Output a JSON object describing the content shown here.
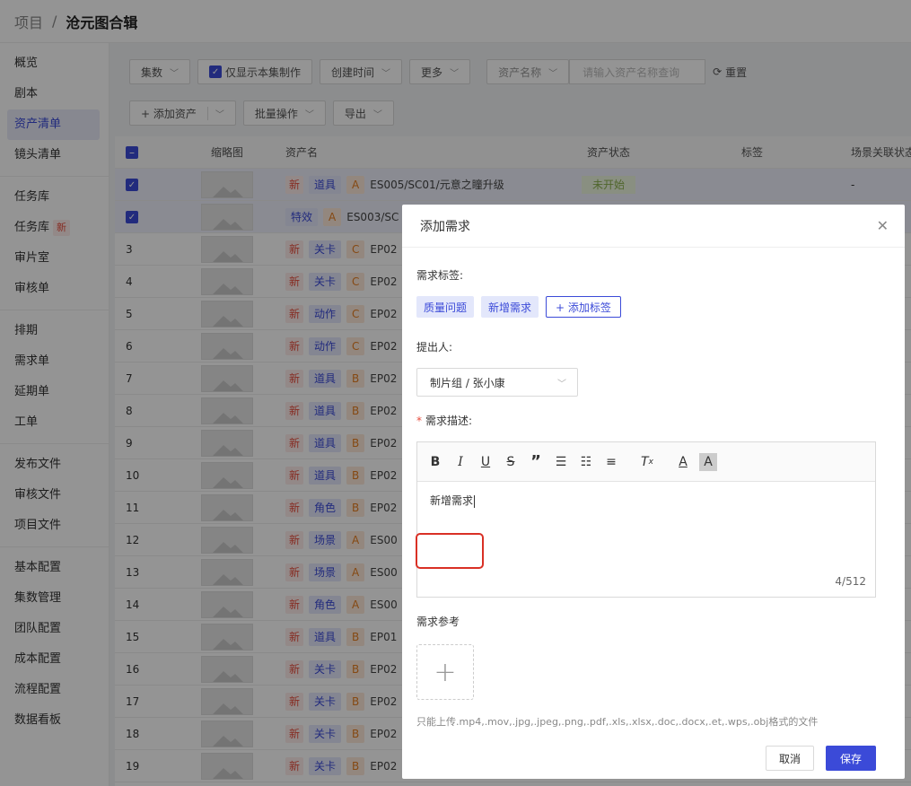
{
  "breadcrumb": {
    "root": "项目",
    "separator": "/",
    "current": "沧元图合辑"
  },
  "sidebar": {
    "groups": [
      [
        "概览",
        "剧本",
        "资产清单",
        "镜头清单"
      ],
      [
        "任务库",
        "任务库",
        "审片室",
        "审核单"
      ],
      [
        "排期",
        "需求单",
        "延期单",
        "工单"
      ],
      [
        "发布文件",
        "审核文件",
        "项目文件"
      ],
      [
        "基本配置",
        "集数管理",
        "团队配置",
        "成本配置",
        "流程配置",
        "数据看板"
      ]
    ],
    "new_badge": "新"
  },
  "toolbar": {
    "episodes": "集数",
    "only_current": "仅显示本集制作",
    "created_time": "创建时间",
    "more": "更多",
    "asset_name": "资产名称",
    "search_placeholder": "请输入资产名称查询",
    "reset": "重置",
    "add_asset": "+ 添加资产",
    "batch": "批量操作",
    "export": "导出"
  },
  "table": {
    "headers": [
      "缩略图",
      "资产名",
      "资产状态",
      "标签",
      "场景关联状态"
    ],
    "rows": [
      {
        "no": "",
        "checked": true,
        "new": "新",
        "type": "道具",
        "grade": "A",
        "name": "ES005/SC01/元意之瞳升级",
        "status": "未开始",
        "link": "-"
      },
      {
        "no": "",
        "checked": true,
        "new": "",
        "type": "特效",
        "grade": "A",
        "name": "ES003/SC",
        "status": "",
        "link": ""
      },
      {
        "no": "3",
        "new": "新",
        "type": "关卡",
        "grade": "C",
        "name": "EP02"
      },
      {
        "no": "4",
        "new": "新",
        "type": "关卡",
        "grade": "C",
        "name": "EP02"
      },
      {
        "no": "5",
        "new": "新",
        "type": "动作",
        "grade": "C",
        "name": "EP02"
      },
      {
        "no": "6",
        "new": "新",
        "type": "动作",
        "grade": "C",
        "name": "EP02"
      },
      {
        "no": "7",
        "new": "新",
        "type": "道具",
        "grade": "B",
        "name": "EP02"
      },
      {
        "no": "8",
        "new": "新",
        "type": "道具",
        "grade": "B",
        "name": "EP02"
      },
      {
        "no": "9",
        "new": "新",
        "type": "道具",
        "grade": "B",
        "name": "EP02"
      },
      {
        "no": "10",
        "new": "新",
        "type": "道具",
        "grade": "B",
        "name": "EP02"
      },
      {
        "no": "11",
        "new": "新",
        "type": "角色",
        "grade": "B",
        "name": "EP02"
      },
      {
        "no": "12",
        "new": "新",
        "type": "场景",
        "grade": "A",
        "name": "ES00"
      },
      {
        "no": "13",
        "new": "新",
        "type": "场景",
        "grade": "A",
        "name": "ES00"
      },
      {
        "no": "14",
        "new": "新",
        "type": "角色",
        "grade": "A",
        "name": "ES00"
      },
      {
        "no": "15",
        "new": "新",
        "type": "道具",
        "grade": "B",
        "name": "EP01"
      },
      {
        "no": "16",
        "new": "新",
        "type": "关卡",
        "grade": "B",
        "name": "EP02"
      },
      {
        "no": "17",
        "new": "新",
        "type": "关卡",
        "grade": "B",
        "name": "EP02"
      },
      {
        "no": "18",
        "new": "新",
        "type": "关卡",
        "grade": "B",
        "name": "EP02"
      },
      {
        "no": "19",
        "new": "新",
        "type": "关卡",
        "grade": "B",
        "name": "EP02"
      }
    ]
  },
  "dialog": {
    "title": "添加需求",
    "tags_label": "需求标签:",
    "tags": [
      "质量问题",
      "新增需求"
    ],
    "add_tag": "+ 添加标签",
    "proposer_label": "提出人:",
    "proposer_value": "制片组 / 张小康",
    "desc_required": "*",
    "desc_label": "需求描述:",
    "desc_value": "新增需求",
    "desc_count": "4/512",
    "ref_label": "需求参考",
    "upload_hint": "只能上传.mp4,.mov,.jpg,.jpeg,.png,.pdf,.xls,.xlsx,.doc,.docx,.et,.wps,.obj格式的文件",
    "cancel": "取消",
    "save": "保存"
  }
}
